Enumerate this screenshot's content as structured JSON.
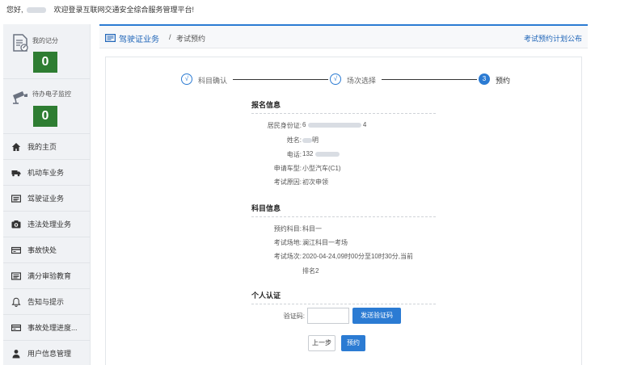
{
  "topbar": {
    "greeting": "您好,",
    "welcome": "欢迎登录互联网交通安全综合服务管理平台!"
  },
  "sidebar": {
    "score_card": {
      "title": "我的记分",
      "value": "0",
      "icon": "score-document-icon"
    },
    "monitor_card": {
      "title": "待办电子监控",
      "value": "0",
      "icon": "camera-icon"
    },
    "items": [
      {
        "label": "我的主页",
        "icon": "home-icon"
      },
      {
        "label": "机动车业务",
        "icon": "truck-icon"
      },
      {
        "label": "驾驶证业务",
        "icon": "license-card-icon"
      },
      {
        "label": "违法处理业务",
        "icon": "camera-icon"
      },
      {
        "label": "事故快处",
        "icon": "card-icon"
      },
      {
        "label": "满分审验教育",
        "icon": "license-card-icon"
      },
      {
        "label": "告知与提示",
        "icon": "bell-icon"
      },
      {
        "label": "事故处理进度...",
        "icon": "card-icon"
      },
      {
        "label": "用户信息管理",
        "icon": "user-icon"
      }
    ]
  },
  "breadcrumb": {
    "main": "驾驶证业务",
    "separator": "/",
    "sub": "考试预约",
    "link": "考试预约计划公布"
  },
  "steps": [
    {
      "num": "√",
      "label": "科目确认",
      "state": "done"
    },
    {
      "num": "√",
      "label": "场次选择",
      "state": "done"
    },
    {
      "num": "3",
      "label": "预约",
      "state": "current"
    }
  ],
  "registration": {
    "title": "报名信息",
    "fields": [
      {
        "label": "居民身份证:",
        "value_prefix": "6",
        "value_suffix": "4"
      },
      {
        "label": "姓名:",
        "value_prefix": "",
        "value_suffix": "明"
      },
      {
        "label": "电话:",
        "value_prefix": "132",
        "value_suffix": ""
      },
      {
        "label": "申请车型:",
        "value_prefix": "小型汽车(C1)",
        "value_suffix": ""
      },
      {
        "label": "考试原因:",
        "value_prefix": "初次申领",
        "value_suffix": ""
      }
    ]
  },
  "subject": {
    "title": "科目信息",
    "fields": [
      {
        "label": "预约科目:",
        "value": "科目一"
      },
      {
        "label": "考试场地:",
        "value": "澜江科目一考场"
      },
      {
        "label": "考试场次:",
        "value": "2020-04-24,09时00分至10时30分,当前"
      }
    ],
    "rank_line": "排名2"
  },
  "auth": {
    "title": "个人认证",
    "code_label": "验证码:",
    "code_value": "",
    "send_button": "发送验证码"
  },
  "actions": {
    "prev": "上一步",
    "book": "预约"
  },
  "colors": {
    "accent": "#2b7bd3",
    "counter_green": "#2e7d32"
  }
}
